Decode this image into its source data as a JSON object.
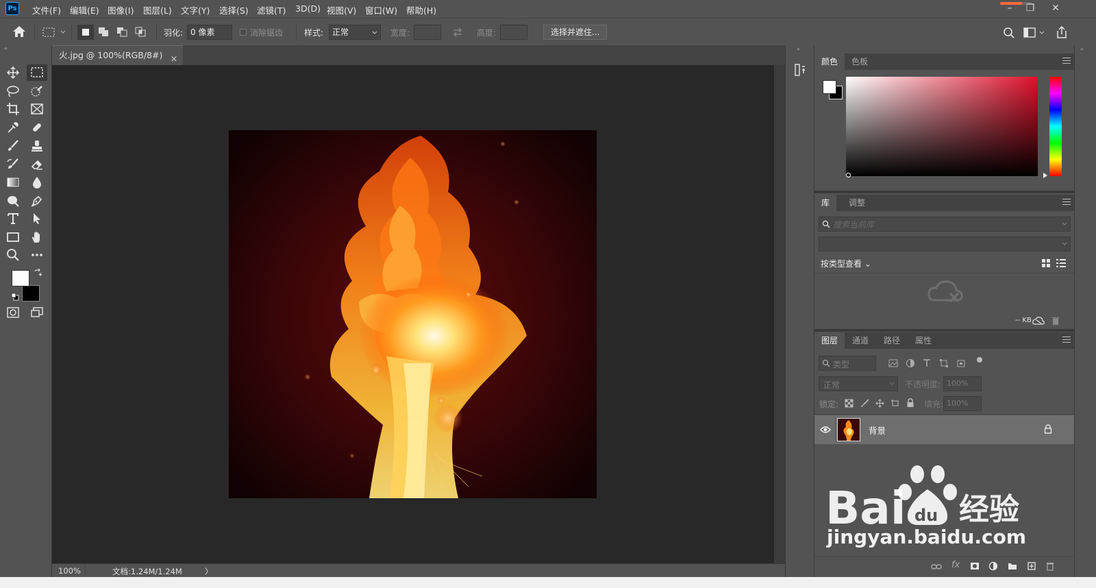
{
  "app": {
    "logo": "Ps"
  },
  "menu": [
    "文件(F)",
    "编辑(E)",
    "图像(I)",
    "图层(L)",
    "文字(Y)",
    "选择(S)",
    "滤镜(T)",
    "3D(D)",
    "视图(V)",
    "窗口(W)",
    "帮助(H)"
  ],
  "window_controls": {
    "minimize": "–",
    "restore": "❐",
    "close": "✕"
  },
  "progress": 0.7,
  "options": {
    "feather_label": "羽化:",
    "feather_value": "0 像素",
    "antialias_label": "消除锯齿",
    "style_label": "样式:",
    "style_value": "正常",
    "width_label": "宽度:",
    "height_label": "高度:",
    "select_mask_button": "选择并遮住..."
  },
  "document": {
    "tab_title": "火.jpg @ 100%(RGB/8#)",
    "tab_close": "×",
    "zoom": "100%",
    "doc_info": "文档:1.24M/1.24M",
    "status_arrow": "〉"
  },
  "color_panel": {
    "tabs": [
      "颜色",
      "色板"
    ],
    "active_tab": 0,
    "foreground": "#ffffff",
    "background": "#000000",
    "picker_hue": "#e0102a"
  },
  "library_panel": {
    "tabs": [
      "库",
      "调整"
    ],
    "active_tab": 0,
    "search_placeholder": "搜索当前库",
    "view_by": "按类型查看",
    "size_label": "-- KB"
  },
  "layers_panel": {
    "tabs": [
      "图层",
      "通道",
      "路径",
      "属性"
    ],
    "active_tab": 0,
    "filter_placeholder": "类型",
    "blend_mode": "正常",
    "opacity_label": "不透明度:",
    "opacity_value": "100%",
    "lock_label": "锁定:",
    "fill_label": "填充:",
    "fill_value": "100%",
    "layers": [
      {
        "name": "背景",
        "visible": true,
        "locked": true
      }
    ]
  },
  "watermark": {
    "brand": "Bai du 经验",
    "url": "jingyan.baidu.com"
  }
}
